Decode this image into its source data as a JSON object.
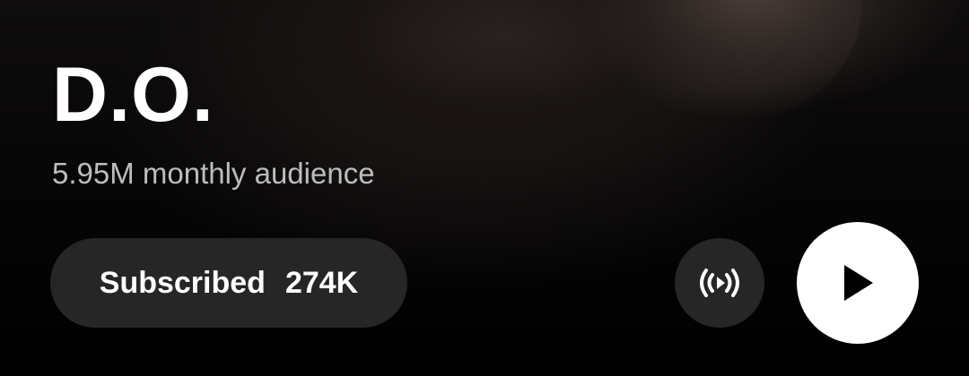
{
  "artist": {
    "name": "D.O.",
    "monthly_audience": "5.95M monthly audience"
  },
  "actions": {
    "subscribe_label": "Subscribed",
    "subscriber_count": "274K",
    "radio_icon": "radio-broadcast-icon",
    "play_icon": "play-icon"
  },
  "colors": {
    "background": "#000000",
    "button_dark": "#262626",
    "button_light": "#ffffff",
    "text_primary": "#ffffff",
    "text_secondary": "#bdbdbd"
  }
}
